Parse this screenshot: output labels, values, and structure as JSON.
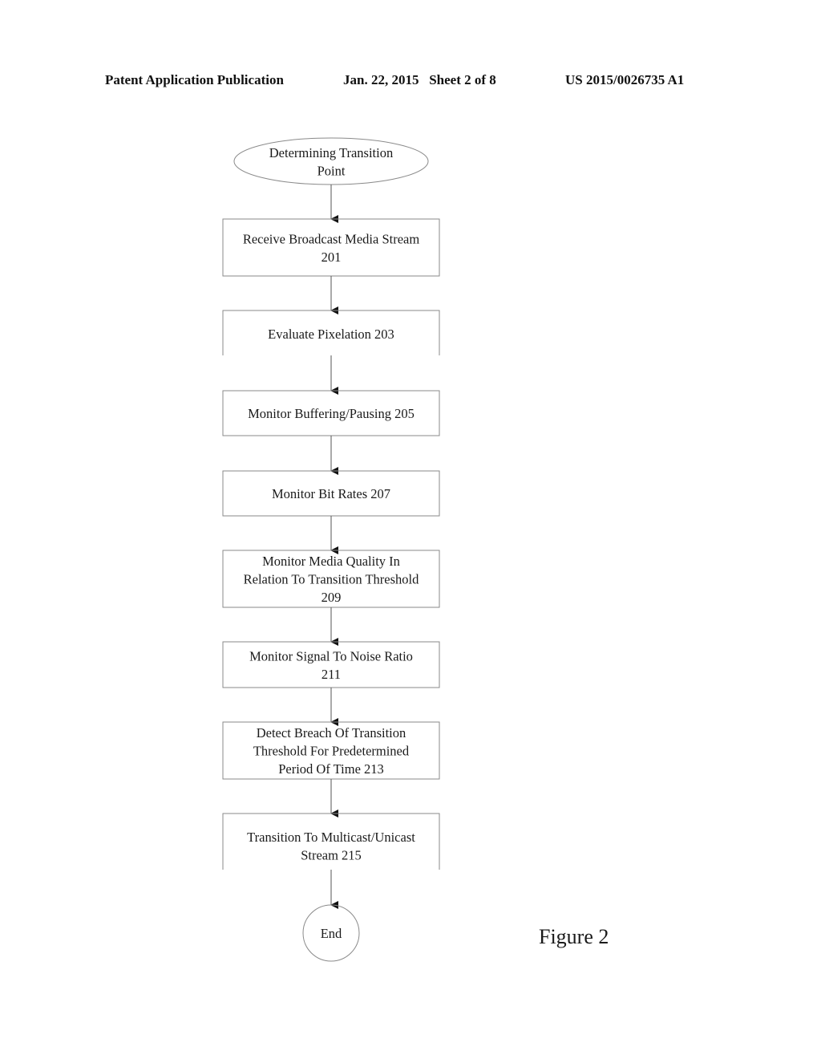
{
  "header": {
    "publication": "Patent Application Publication",
    "date_sheet": "Jan. 22, 2015   Sheet 2 of 8",
    "number": "US 2015/0026735 A1"
  },
  "flowchart": {
    "start": {
      "lines": [
        "Determining Transition",
        "Point"
      ]
    },
    "steps": [
      {
        "id": "201",
        "lines": [
          "Receive Broadcast Media Stream",
          "201"
        ]
      },
      {
        "id": "203",
        "lines": [
          "Evaluate Pixelation 203"
        ]
      },
      {
        "id": "205",
        "lines": [
          "Monitor Buffering/Pausing 205"
        ]
      },
      {
        "id": "207",
        "lines": [
          "Monitor Bit Rates 207"
        ]
      },
      {
        "id": "209",
        "lines": [
          "Monitor Media Quality In",
          "Relation To Transition Threshold",
          "209"
        ]
      },
      {
        "id": "211",
        "lines": [
          "Monitor Signal To Noise Ratio",
          "211"
        ]
      },
      {
        "id": "213",
        "lines": [
          "Detect Breach Of Transition",
          "Threshold For Predetermined",
          "Period Of Time 213"
        ]
      },
      {
        "id": "215",
        "lines": [
          "Transition To Multicast/Unicast",
          "Stream 215"
        ]
      }
    ],
    "end": {
      "label": "End"
    }
  },
  "figure_label": "Figure 2"
}
